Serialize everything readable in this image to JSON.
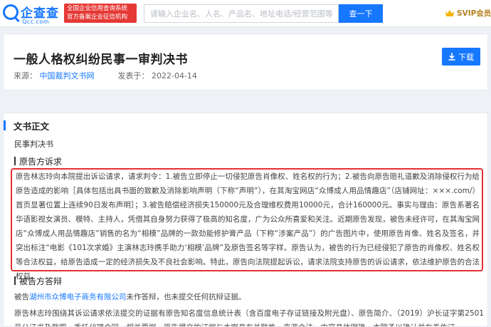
{
  "header": {
    "logo_text": "企查查",
    "logo_domain": "Qcc.com",
    "badge_line1": "全国企业信用查询系统",
    "badge_line2": "官方备案企业征信机构",
    "search_placeholder": "请输入企业名、人名、产品名、地址电话/经营范围等",
    "search_button": "查一下",
    "svip_label": "SVIP会员"
  },
  "document": {
    "title": "一般人格权纠纷民事一审判决书",
    "source_label": "来源：",
    "source_value": "中国裁判文书网",
    "date_label": "发表于：",
    "date_value": "2022-04-14",
    "download_label": "下载"
  },
  "body": {
    "section_title": "文书正文",
    "doc_type": "民事判决书",
    "plaintiff_heading": "原告方诉求",
    "plaintiff_text": "原告林志玲向本院提出诉讼请求，请求判令：1.被告立即停止一切侵犯原告肖像权、姓名权的行为；2.被告向原告赔礼道歉及消除侵权行为给原告造成的影响［具体包括出具书面的致歉及消除影响声明（下称“声明”），在其淘宝网店“众博成人用品情趣店”（店铺网址：×××.com/）首页显著位置上连续90日发布声明］；3.被告赔偿经济损失150000元及合理维权费用10000元，合计160000元。事实与理由：原告系著名华语影视女演员、模特、主持人，凭借其自身努力获得了极高的知名度，广为公众所喜爱和关注。近期原告发现，被告未经许可，在其淘宝网店“众博成人用品情趣店”销售的名为“相模”品牌的一款劲能修护膏产品（下称“涉案产品”）的广告图片中，使用原告肖像、姓名及签名，并突出标注“电影《101次求婚》主演林志玲携手助力‘相模’品牌”及原告签名等字样。原告认为，被告的行为已经侵犯了原告的肖像权、姓名权等合法权益，给原告造成一定的经济损失及不良社会影响。特此，原告向法院提起诉讼，请求法院支持原告的诉讼请求，依法维护原告的合法权益。",
    "defendant_heading": "被告方答辩",
    "defendant_prefix": "被告",
    "defendant_company": "湖州市众博电子商务有限公司",
    "defendant_suffix": "未作答辩，也未提交任何抗辩证据。",
    "evidence_text": "原告林志玲围绕其诉讼请求依法提交的证据有原告知名度信息统计表（含百度电子存证链接及附光盘）、原告简介、（2019）沪长证字第2501号公证书及截图、委托代理合同、相关票据，原告提交的证据与本案具有关联性，来源合法，内容具体明确，本院予以确认并在卷佐证。"
  },
  "colors": {
    "brand_blue": "#1677ff",
    "badge_red": "#e53935",
    "highlight_red": "#e53030",
    "vip_gold": "#b3821f"
  },
  "icons": [
    "logo-mark",
    "crown-icon",
    "download-icon"
  ]
}
